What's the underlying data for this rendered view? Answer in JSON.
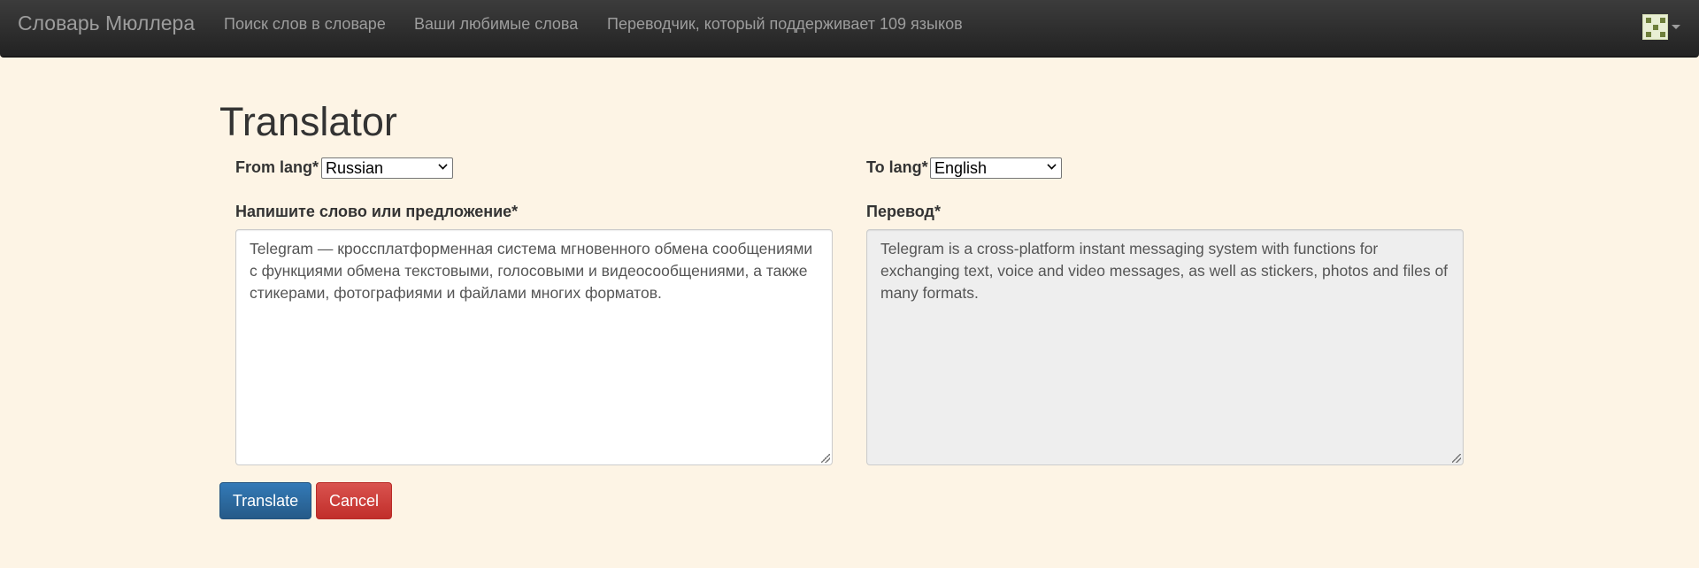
{
  "navbar": {
    "brand": "Словарь Мюллера",
    "links": [
      "Поиск слов в словаре",
      "Ваши любимые слова",
      "Переводчик, который поддерживает 109 языков"
    ],
    "user_icon": "avatar-identicon"
  },
  "main": {
    "title": "Translator",
    "from_lang": {
      "label": "From lang",
      "required_mark": "*",
      "selected": "Russian"
    },
    "to_lang": {
      "label": "To lang",
      "required_mark": "*",
      "selected": "English"
    },
    "source": {
      "label": "Напишите слово или предложение*",
      "value": "Telegram — кроссплатформенная система мгновенного обмена сообщениями с функциями обмена текстовыми, голосовыми и видеосообщениями, а также стикерами, фотографиями и файлами многих форматов."
    },
    "translation": {
      "label": "Перевод*",
      "value": "Telegram is a cross-platform instant messaging system with functions for exchanging text, voice and video messages, as well as stickers, photos and files of many formats."
    },
    "buttons": {
      "translate": "Translate",
      "cancel": "Cancel"
    }
  },
  "colors": {
    "page_background": "#fdf4e5",
    "navbar": "#2b2b2b",
    "primary_button": "#2e6da4",
    "danger_button": "#d43f3a",
    "readonly_field": "#eeeeee"
  }
}
